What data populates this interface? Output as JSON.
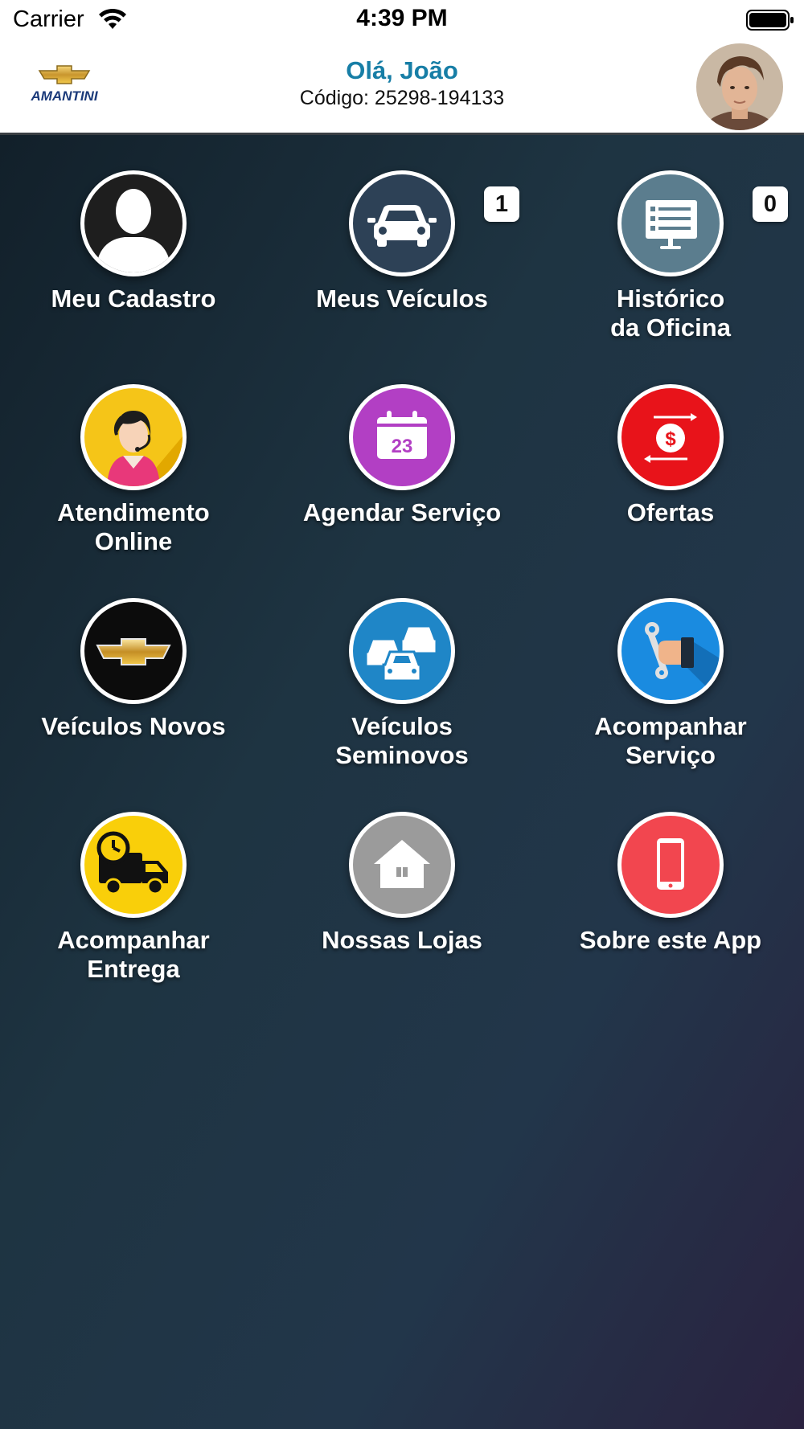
{
  "status_bar": {
    "carrier": "Carrier",
    "time": "4:39 PM"
  },
  "header": {
    "logo_text": "AMANTINI",
    "greeting": "Olá, João",
    "code": "Código: 25298-194133"
  },
  "colors": {
    "accent": "#177ea6",
    "header_bg": "#ffffff"
  },
  "menu": [
    {
      "line1": "Meu Cadastro",
      "line2": "",
      "icon": "user-silhouette-icon"
    },
    {
      "line1": "Meus Veículos",
      "line2": "",
      "icon": "car-icon",
      "badge": "1"
    },
    {
      "line1": "Histórico",
      "line2": "da Oficina",
      "icon": "list-screen-icon",
      "badge": "0"
    },
    {
      "line1": "Atendimento",
      "line2": "Online",
      "icon": "support-agent-icon"
    },
    {
      "line1": "Agendar Serviço",
      "line2": "",
      "icon": "calendar-icon",
      "calendar_day": "23"
    },
    {
      "line1": "Ofertas",
      "line2": "",
      "icon": "dollar-exchange-icon"
    },
    {
      "line1": "Veículos Novos",
      "line2": "",
      "icon": "chevrolet-bowtie-icon"
    },
    {
      "line1": "Veículos",
      "line2": "Seminovos",
      "icon": "cars-icon"
    },
    {
      "line1": "Acompanhar",
      "line2": "Serviço",
      "icon": "hand-wrench-icon"
    },
    {
      "line1": "Acompanhar",
      "line2": "Entrega",
      "icon": "delivery-truck-icon"
    },
    {
      "line1": "Nossas Lojas",
      "line2": "",
      "icon": "store-house-icon"
    },
    {
      "line1": "Sobre este App",
      "line2": "",
      "icon": "smartphone-icon"
    }
  ]
}
